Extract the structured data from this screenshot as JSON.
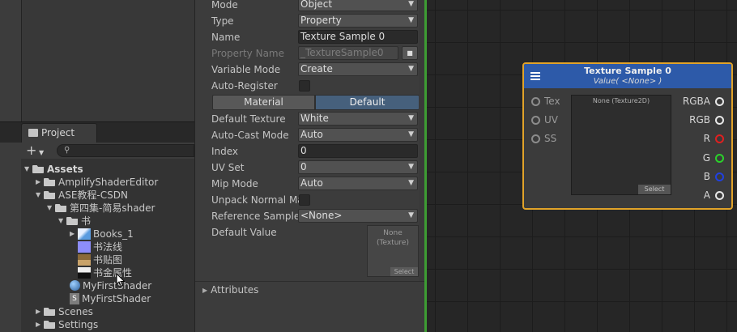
{
  "project_panel": {
    "tab_label": "Project",
    "add_button": "+",
    "tree": [
      {
        "label": "Assets"
      },
      {
        "label": "AmplifyShaderEditor"
      },
      {
        "label": "ASE教程-CSDN"
      },
      {
        "label": "第四集-简易shader"
      },
      {
        "label": "书"
      },
      {
        "label": "Books_1"
      },
      {
        "label": "书法线"
      },
      {
        "label": "书贴图"
      },
      {
        "label": "书金属性"
      },
      {
        "label": "MyFirstShader"
      },
      {
        "label": "MyFirstShader"
      },
      {
        "label": "Scenes"
      },
      {
        "label": "Settings"
      }
    ]
  },
  "inspector": {
    "rows": [
      {
        "label": "Mode",
        "value": "Object"
      },
      {
        "label": "Type",
        "value": "Property"
      },
      {
        "label": "Name",
        "value": "Texture Sample 0"
      },
      {
        "label": "Property Name",
        "value": "_TextureSample0"
      },
      {
        "label": "Variable Mode",
        "value": "Create"
      },
      {
        "label": "Auto-Register",
        "value": ""
      },
      {
        "label": "Default Texture",
        "value": "White"
      },
      {
        "label": "Auto-Cast Mode",
        "value": "Auto"
      },
      {
        "label": "Index",
        "value": "0"
      },
      {
        "label": "UV Set",
        "value": "0"
      },
      {
        "label": "Mip Mode",
        "value": "Auto"
      },
      {
        "label": "Unpack Normal Ma",
        "value": ""
      },
      {
        "label": "Reference Sample",
        "value": "<None>"
      },
      {
        "label": "Default Value",
        "value": ""
      }
    ],
    "tabs": {
      "material": "Material",
      "default": "Default"
    },
    "default_value_box": {
      "line1": "None",
      "line2": "(Texture)",
      "select": "Select"
    },
    "attributes_label": "Attributes"
  },
  "node": {
    "title": "Texture Sample 0",
    "subtitle": "Value( <None> )",
    "inputs": [
      "Tex",
      "UV",
      "SS"
    ],
    "outputs": [
      {
        "label": "RGBA",
        "color": "#e8e8e8"
      },
      {
        "label": "RGB",
        "color": "#e8e8e8"
      },
      {
        "label": "R",
        "color": "#e02020"
      },
      {
        "label": "G",
        "color": "#2bd12b"
      },
      {
        "label": "B",
        "color": "#2040e0"
      },
      {
        "label": "A",
        "color": "#e8e8e8"
      }
    ],
    "preview": {
      "label": "None (Texture2D)",
      "select": "Select"
    },
    "border_color": "#e1a329",
    "header_color": "#2d5aa9"
  },
  "colors": {
    "separator": "#3d9c33",
    "active_tab": "#46607c"
  }
}
